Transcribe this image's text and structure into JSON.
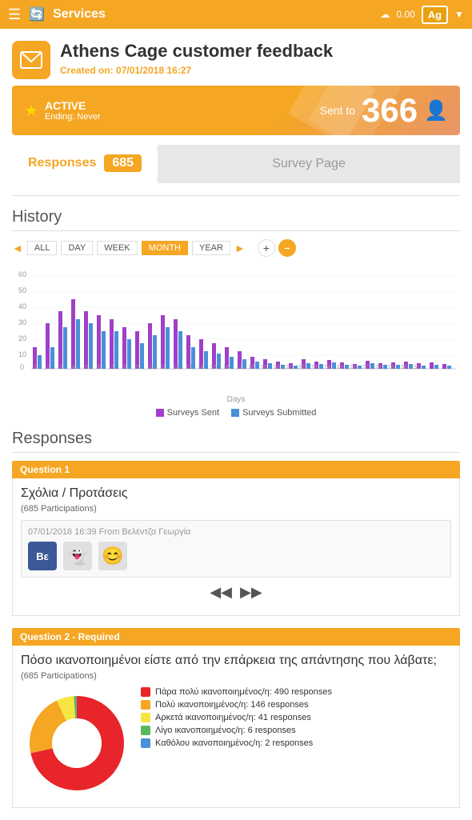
{
  "nav": {
    "title": "Services",
    "balance": "0.00",
    "avatar": "Ag"
  },
  "header": {
    "title": "Athens Cage customer feedback",
    "created_label": "Created on:",
    "created_date": "07/01/2018 16:27"
  },
  "status": {
    "active_label": "ACTIVE",
    "ending_label": "Ending: Never",
    "sent_to_label": "Sent to",
    "sent_to_number": "366"
  },
  "tabs": {
    "responses_label": "Responses",
    "responses_count": "685",
    "survey_label": "Survey Page"
  },
  "history": {
    "section_title": "History",
    "controls": [
      "ALL",
      "DAY",
      "WEEK",
      "MONTH",
      "YEAR"
    ],
    "active_control": "MONTH",
    "x_label": "Days",
    "legend": [
      {
        "label": "Surveys Sent",
        "color": "#a040c8"
      },
      {
        "label": "Surveys Submitted",
        "color": "#4a90d9"
      }
    ]
  },
  "responses_section": {
    "title": "Responses",
    "question1": {
      "label": "Question 1",
      "title": "Σχόλια / Προτάσεις",
      "participations": "(685 Participations)",
      "response_meta": "07/01/2018 16:39 From Βελέντζα Γεωργία",
      "icons": [
        "Bε",
        "👻",
        "😊"
      ]
    },
    "question2": {
      "label": "Question 2 - Required",
      "title": "Πόσο ικανοποιημένοι είστε από την επάρκεια της απάντησης που λάβατε;",
      "participations": "(685 Participations)",
      "legend": [
        {
          "label": "Πάρα πολύ ικανοποιημένος/η: 490 responses",
          "color": "#e8252a"
        },
        {
          "label": "Πολύ ικανοποιημένος/η: 146 responses",
          "color": "#f5a623"
        },
        {
          "label": "Αρκετά ικανοποιημένος/η: 41 responses",
          "color": "#f5e642"
        },
        {
          "label": "Λίγο ικανοποιημένος/η: 6 responses",
          "color": "#5cb85c"
        },
        {
          "label": "Καθόλου ικανοποιημένος/η: 2 responses",
          "color": "#4a90d9"
        }
      ],
      "donut": {
        "segments": [
          {
            "value": 490,
            "color": "#e8252a"
          },
          {
            "value": 146,
            "color": "#f5a623"
          },
          {
            "value": 41,
            "color": "#f5e642"
          },
          {
            "value": 6,
            "color": "#5cb85c"
          },
          {
            "value": 2,
            "color": "#4a90d9"
          }
        ]
      }
    }
  }
}
